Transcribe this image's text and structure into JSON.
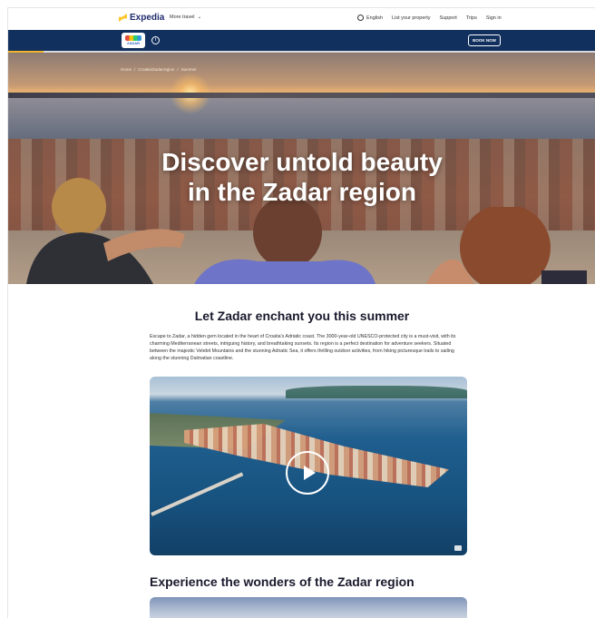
{
  "topnav": {
    "brand": "Expedia",
    "more_travel": "More travel",
    "language": "English",
    "list_property": "List your property",
    "support": "Support",
    "trips": "Trips",
    "sign_in": "Sign in"
  },
  "campaign_bar": {
    "badge_text": "ZADAR",
    "book_now": "BOOK NOW",
    "progress_fraction": 0.06
  },
  "hero": {
    "breadcrumb": [
      "Home",
      "Croatia/Zadarregion",
      "Summer"
    ],
    "title_line1": "Discover untold beauty",
    "title_line2": "in the Zadar region"
  },
  "intro": {
    "heading": "Let Zadar enchant you this summer",
    "body": "Escape to Zadar, a hidden gem located in the heart of Croatia's Adriatic coast. The 3000-year-old UNESCO-protected city is a must-visit, with its charming Mediterranean streets, intriguing history, and breathtaking sunsets. Its region is a perfect destination for adventure seekers. Situated between the majestic Velebit Mountains and the stunning Adriatic Sea, it offers thrilling outdoor activities, from hiking picturesque trails to sailing along the stunning Dalmatian coastline."
  },
  "video": {
    "play_icon": "play-icon",
    "caption_icon": "closed-caption-icon"
  },
  "section2": {
    "heading": "Experience the wonders of the Zadar region"
  },
  "colors": {
    "brand_navy": "#12305e",
    "accent_yellow": "#ffc72c",
    "text_dark": "#1a1a2e"
  }
}
